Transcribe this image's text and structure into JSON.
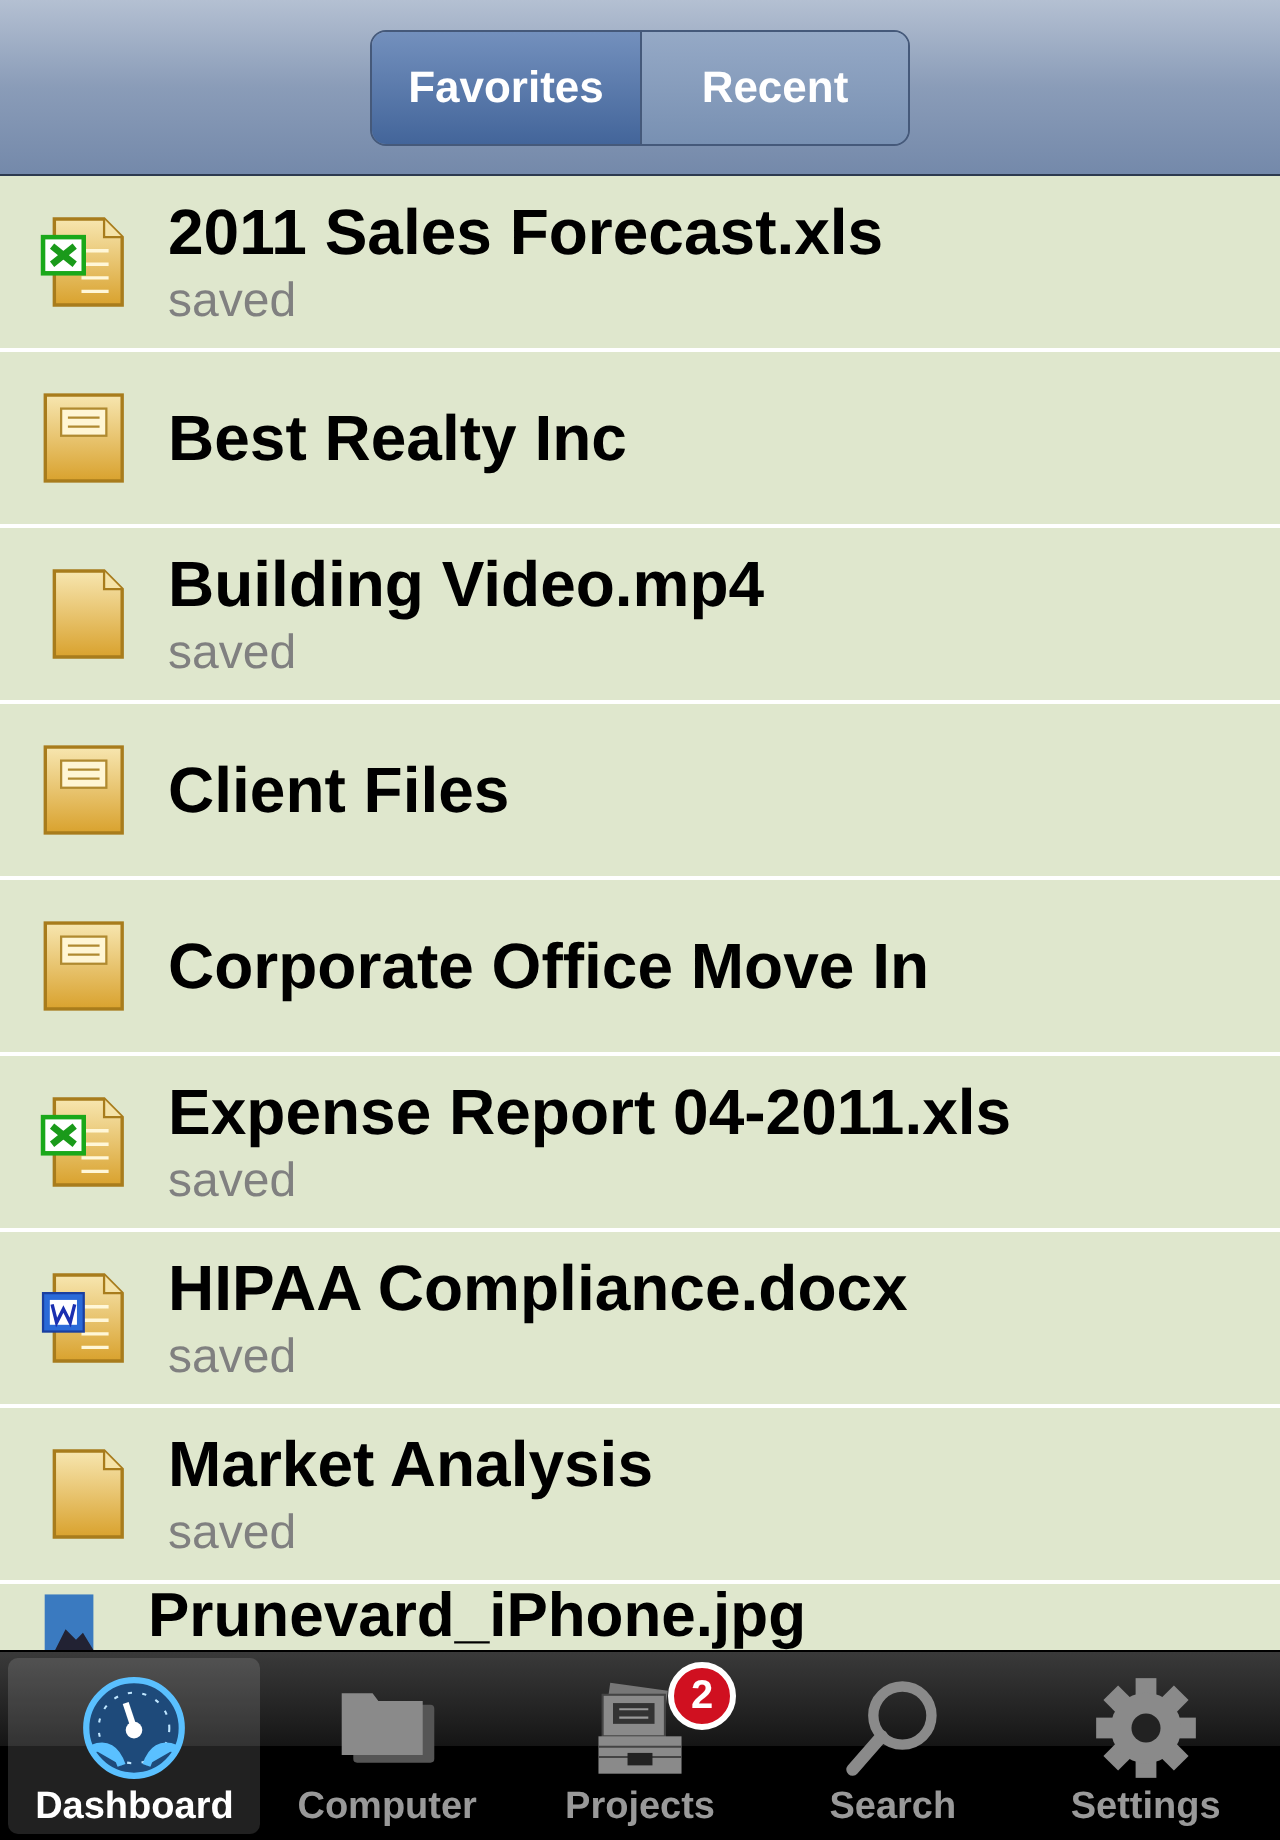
{
  "segments": [
    {
      "label": "Favorites",
      "selected": true
    },
    {
      "label": "Recent",
      "selected": false
    }
  ],
  "items": [
    {
      "name": "2011 Sales Forecast.xls",
      "status": "saved",
      "kind": "excel"
    },
    {
      "name": "Best Realty Inc",
      "kind": "folder"
    },
    {
      "name": "Building Video.mp4",
      "status": "saved",
      "kind": "file"
    },
    {
      "name": "Client Files",
      "kind": "folder"
    },
    {
      "name": "Corporate Office Move In",
      "kind": "folder"
    },
    {
      "name": "Expense Report 04-2011.xls",
      "status": "saved",
      "kind": "excel"
    },
    {
      "name": "HIPAA Compliance.docx",
      "status": "saved",
      "kind": "word"
    },
    {
      "name": "Market Analysis",
      "status": "saved",
      "kind": "file"
    },
    {
      "name": "Prunevard_iPhone.jpg",
      "kind": "image"
    }
  ],
  "tabs": [
    {
      "label": "Dashboard",
      "selected": true,
      "kind": "gauge"
    },
    {
      "label": "Computer",
      "selected": false,
      "kind": "folders"
    },
    {
      "label": "Projects",
      "selected": false,
      "kind": "projects",
      "badge": "2"
    },
    {
      "label": "Search",
      "selected": false,
      "kind": "search"
    },
    {
      "label": "Settings",
      "selected": false,
      "kind": "gear"
    }
  ]
}
